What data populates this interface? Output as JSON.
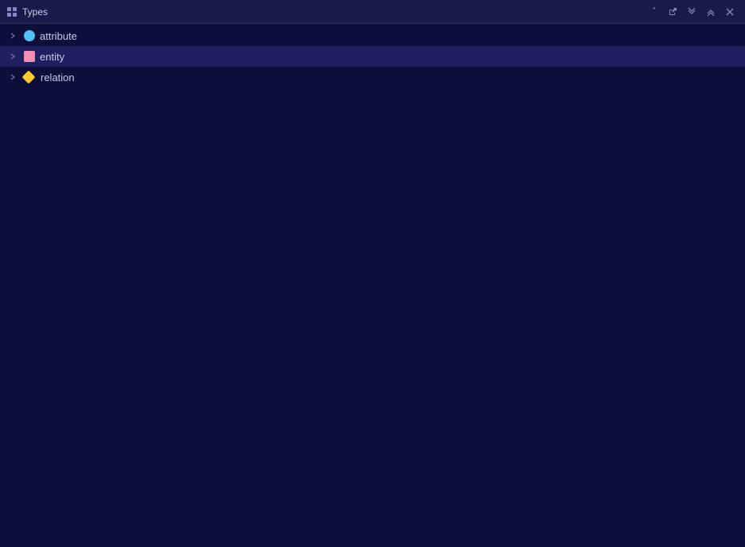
{
  "titleBar": {
    "title": "Types",
    "buttons": [
      {
        "name": "refresh",
        "symbol": "↺"
      },
      {
        "name": "external-link",
        "symbol": "⧉"
      },
      {
        "name": "collapse-all",
        "symbol": "⌄⌄"
      },
      {
        "name": "expand-all",
        "symbol": "⌃⌃"
      },
      {
        "name": "close",
        "symbol": "✕"
      }
    ]
  },
  "treeItems": [
    {
      "id": "attribute",
      "label": "attribute",
      "iconColor": "#4fc3f7",
      "iconShape": "circle",
      "selected": false,
      "expanded": false
    },
    {
      "id": "entity",
      "label": "entity",
      "iconColor": "#f48fb1",
      "iconShape": "square",
      "selected": true,
      "expanded": false
    },
    {
      "id": "relation",
      "label": "relation",
      "iconColor": "#ffca28",
      "iconShape": "diamond",
      "selected": false,
      "expanded": false
    }
  ]
}
